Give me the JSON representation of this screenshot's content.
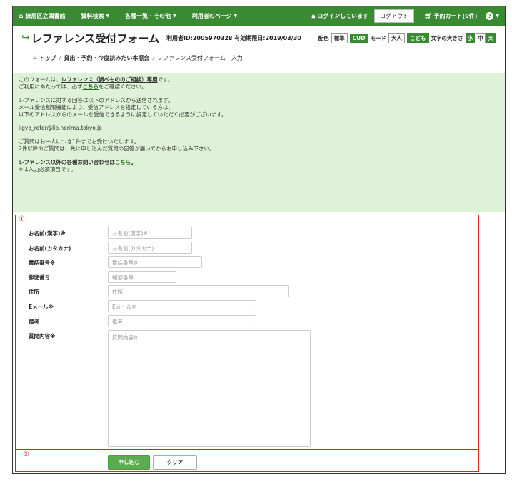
{
  "nav": {
    "library": "練馬区立図書館",
    "menu": [
      "資料検索",
      "各種一覧・その他",
      "利用者のページ"
    ],
    "login_status": "ログインしています",
    "logout_label": "ログアウト",
    "cart_label": "予約カート(0件)"
  },
  "header": {
    "title": "レファレンス受付フォーム",
    "user_info": "利用者ID:2005970328 有効期限日:2019/03/30",
    "color_label": "配色",
    "color_standard": "標準",
    "color_cud": "CUD",
    "mode_label": "モード",
    "mode_adult": "大人",
    "mode_child": "こども",
    "font_size_label": "文字の大きさ",
    "font_small": "小",
    "font_medium": "中",
    "font_large": "大"
  },
  "breadcrumb": {
    "home": "トップ",
    "crumb2": "貸出・予約・今度読みたい本照会",
    "current": "レファレンス受付フォーム－入力"
  },
  "info": {
    "l1a": "このフォームは、",
    "l1b": "レファレンス（調べもののご相談）専用",
    "l1c": "です。",
    "l2a": "ご利用にあたっては、必ず",
    "l2b": "こちら",
    "l2c": "をご確認ください。",
    "l3": "レファレンスに対する回答は以下のアドレスから送信されます。",
    "l4": "メール受信制限機能により、受信アドレスを指定している方は、",
    "l5": "以下のアドレスからのメールを受信できるように設定していただく必要がございます。",
    "email": "jigyo_refer@lib.nerima.tokyo.jp",
    "l6": "ご質問はお一人につき1件までお受けいたします。",
    "l7": "2件以降のご質問は、先に申し込んだ質問の回答が届いてからお申し込み下さい。",
    "l8a": "レファレンス以外の各種お問い合わせは",
    "l8b": "こちら",
    "l8c": "。",
    "l9": "※は入力必須項目です。"
  },
  "markers": {
    "m1": "①",
    "m2": "②"
  },
  "form": {
    "name_kanji_label": "お名前(漢字)※",
    "name_kanji_ph": "お名前(漢字)※",
    "name_kana_label": "お名前(カタカナ)",
    "name_kana_ph": "お名前(カタカナ)",
    "phone_label": "電話番号※",
    "phone_ph": "電話番号※",
    "zip_label": "郵便番号",
    "zip_ph": "郵便番号",
    "address_label": "住所",
    "address_ph": "住所",
    "email_label": "Eメール※",
    "email_ph": "Eメール※",
    "note_label": "備考",
    "note_ph": "備考",
    "question_label": "質問内容※",
    "question_ph": "質問内容※"
  },
  "actions": {
    "submit": "申し込む",
    "clear": "クリア"
  },
  "colors": {
    "nav_bg": "#3a8a33",
    "info_bg": "#ddf2d6",
    "annotation": "#e02020",
    "submit_bg": "#5bab4f"
  }
}
